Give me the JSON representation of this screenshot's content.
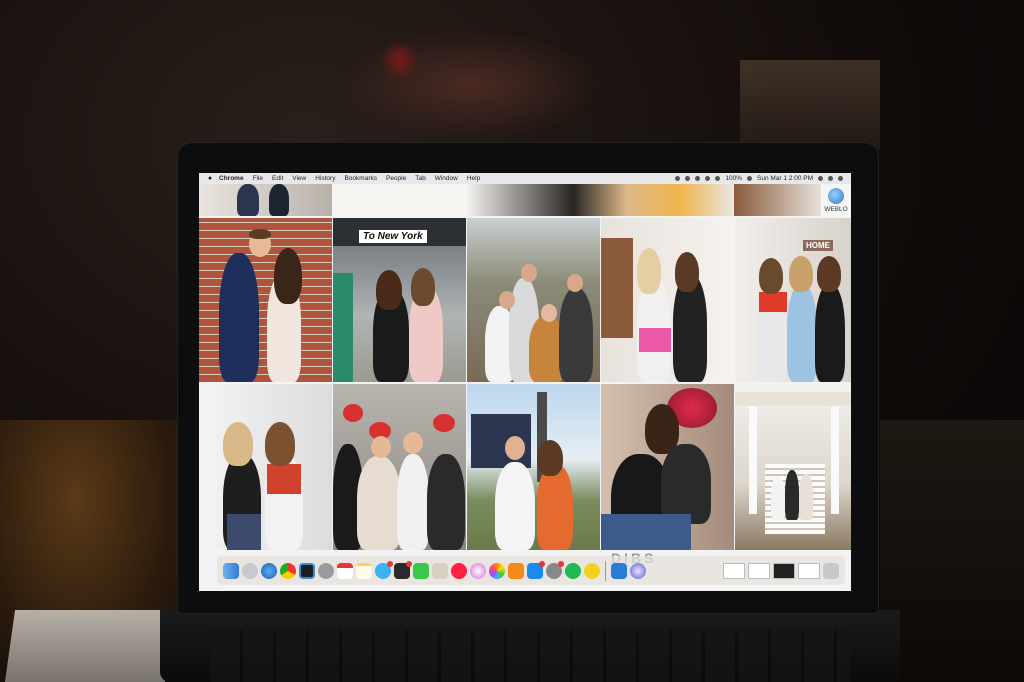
{
  "menubar": {
    "app_name": "Chrome",
    "items": [
      "File",
      "Edit",
      "View",
      "History",
      "Bookmarks",
      "People",
      "Tab",
      "Window",
      "Help"
    ],
    "battery": "100%",
    "clock": "Sun Mar 1  2:00 PM"
  },
  "photos": {
    "station_sign": "To New York",
    "home_sign": "HOME"
  },
  "desktop": {
    "webloc_label": "WEBLO"
  },
  "screen_text": {
    "partial_banner": "DIBS"
  },
  "dock": {
    "icons": [
      "finder-icon",
      "launchpad-icon",
      "safari-icon",
      "chrome-icon",
      "screen-icon",
      "rocket-icon",
      "calendar-icon",
      "notes-icon",
      "messages-icon",
      "photos-booth-icon",
      "facetime-icon",
      "preview-icon",
      "news-icon",
      "itunes-icon",
      "photos-icon",
      "books-icon",
      "app-store-icon",
      "system-preferences-icon",
      "spotify-icon",
      "cyberduck-icon",
      "keynote-icon",
      "siri-icon"
    ]
  },
  "colors": {
    "menubar": "#e8e8ea",
    "collage_bg": "#f3f3f3"
  }
}
